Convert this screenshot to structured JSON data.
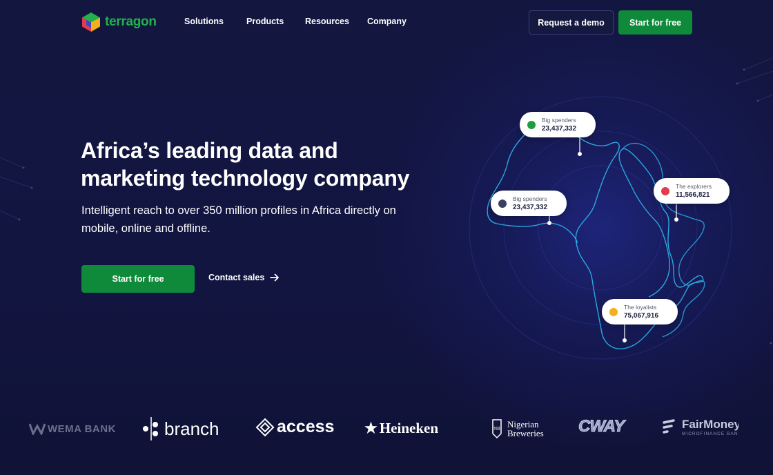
{
  "header": {
    "logo_text": "terragon",
    "nav": [
      "Solutions",
      "Products",
      "Resources",
      "Company"
    ],
    "request_demo": "Request a demo",
    "start_free": "Start for free"
  },
  "hero": {
    "title_line1": "Africa’s leading data and",
    "title_line2": "marketing technology company",
    "subtitle_line1": "Intelligent reach to over 350 million profiles in Africa directly on",
    "subtitle_line2": "mobile, online and offline.",
    "cta_primary": "Start for free",
    "cta_secondary": "Contact sales"
  },
  "map_callouts": [
    {
      "label": "Big spenders",
      "value": "23,437,332",
      "color": "#1f9d3f"
    },
    {
      "label": "The explorers",
      "value": "11,566,821",
      "color": "#e23b4b"
    },
    {
      "label": "Big spenders",
      "value": "23,437,332",
      "color": "#3a3f63"
    },
    {
      "label": "The loyalists",
      "value": "75,067,916",
      "color": "#f2b01e"
    }
  ],
  "partners": {
    "wema": "WEMA BANK",
    "branch": "branch",
    "access": "access",
    "heineken": "Heineken",
    "ng_line1": "Nigerian",
    "ng_line2": "Breweries",
    "cway": "CWAY",
    "fair_name": "FairMoney",
    "fair_sub": "MICROFINANCE BANK"
  },
  "colors": {
    "background": "#121540",
    "accent_green": "#0f8a3a",
    "map_line": "#2aa8e0"
  }
}
